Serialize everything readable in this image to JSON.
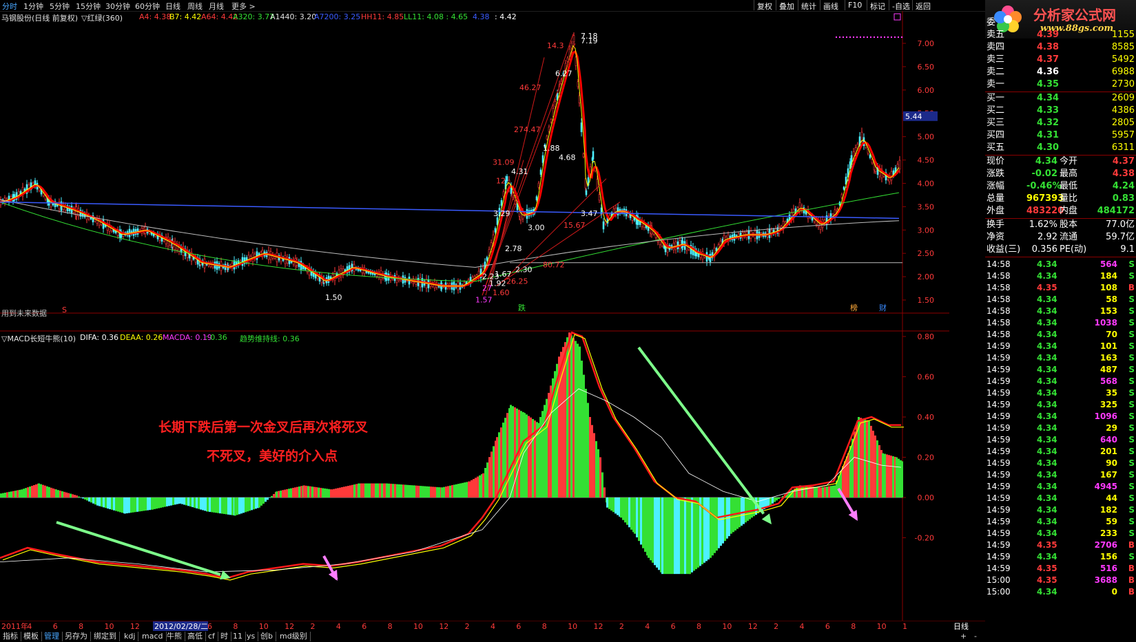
{
  "topbar": {
    "tabs": [
      "分时",
      "1分钟",
      "5分钟",
      "15分钟",
      "30分钟",
      "60分钟",
      "日线",
      "周线",
      "月线",
      "更多 >"
    ],
    "buttons": [
      "复权",
      "叠加",
      "统计",
      "画线",
      "F10",
      "标记",
      "-自选",
      "返回"
    ]
  },
  "logo": {
    "line1": "分析家公式网",
    "line2": "www.88gs.com"
  },
  "main_info": {
    "title": "马钢股份(日线 前复权)",
    "indicator": "▽红绿(360)",
    "items": [
      {
        "label": "A4: 4.38",
        "color": "#ff3a3a"
      },
      {
        "label": "B7: 4.42",
        "color": "#ffff00"
      },
      {
        "label": "A64: 4.42",
        "color": "#ff3a3a"
      },
      {
        "label": "A320: 3.77",
        "color": "#34e034"
      },
      {
        "label": "A1440: 3.20",
        "color": "#e0e0e0"
      },
      {
        "label": "A7200: 3.25",
        "color": "#3a5bff"
      },
      {
        "label": "HH11: 4.85",
        "color": "#ff3a3a"
      },
      {
        "label": "LL11: 4.08 : 4.65",
        "color": "#34e034"
      },
      {
        "label": "4.38",
        "color": "#3a5bff"
      },
      {
        "label": ": 4.42",
        "color": "#ffffff"
      }
    ]
  },
  "macd_info": {
    "title": "▽MACD长短牛熊(10)",
    "items": [
      {
        "label": "DIFA: 0.36",
        "color": "#ffffff"
      },
      {
        "label": "DEAA: 0.26",
        "color": "#ffff00"
      },
      {
        "label": "MACDA: 0.19",
        "color": "#ff3aff"
      },
      {
        "label": ": 0.36",
        "color": "#34e034"
      },
      {
        "label": "趋势维持线: 0.36",
        "color": "#34e034"
      }
    ]
  },
  "future_note": "用到未来数据",
  "annotations": {
    "line1": "长期下跌后第一次金叉后再次将死叉",
    "line2": "不死叉，美好的介入点"
  },
  "price_axis": {
    "labels": [
      "7.00",
      "6.50",
      "6.00",
      "5.50",
      "5.00",
      "4.50",
      "4.00",
      "3.50",
      "3.00",
      "2.50",
      "2.00",
      "1.50"
    ],
    "current": "5.44"
  },
  "macd_axis": {
    "labels": [
      "0.80",
      "0.60",
      "0.40",
      "0.20",
      "0.00",
      "-0.20"
    ]
  },
  "chart_labels": {
    "prices": [
      "7.18",
      "7.19",
      "14.3",
      "6.27",
      "46.27",
      "274.47",
      "31.09",
      "4.31",
      "12",
      "4.68",
      "1.88",
      "3.29",
      "3.00",
      "3.47",
      "15.67",
      "2.78",
      "2.30",
      "80.72",
      "26.25",
      "1.92",
      "1.60",
      "1.50",
      "1.57",
      "2.23",
      "1.67",
      "27"
    ],
    "markers": [
      "跌",
      "榜",
      "财",
      "S"
    ]
  },
  "xaxis": {
    "labels": [
      "2011年",
      "4",
      "6",
      "8",
      "10",
      "12",
      "2",
      "4",
      "6",
      "8",
      "10",
      "12",
      "2",
      "4",
      "6",
      "8",
      "10",
      "12",
      "2",
      "4",
      "6",
      "8",
      "10",
      "12",
      "2",
      "4",
      "6",
      "8",
      "10",
      "12",
      "2",
      "4",
      "6",
      "8",
      "10",
      "1"
    ],
    "cursor": "2012/02/28/二",
    "period": "日线"
  },
  "bottombar": {
    "items": [
      "指标",
      "模板",
      "管理",
      "另存为",
      "绑定到",
      "kdj",
      "macd",
      "牛熊",
      "高低",
      "cf",
      "时",
      "11",
      "ys",
      "创b",
      "md级别"
    ],
    "active": "管理",
    "plus": "+",
    "minus": "-"
  },
  "orderbook": {
    "header": "委",
    "sells": [
      {
        "label": "卖五",
        "price": "4.39",
        "vol": "1155"
      },
      {
        "label": "卖四",
        "price": "4.38",
        "vol": "8585"
      },
      {
        "label": "卖三",
        "price": "4.37",
        "vol": "5492"
      },
      {
        "label": "卖二",
        "price": "4.36",
        "vol": "6988"
      },
      {
        "label": "卖一",
        "price": "4.35",
        "vol": "2730"
      }
    ],
    "buys": [
      {
        "label": "买一",
        "price": "4.34",
        "vol": "2609"
      },
      {
        "label": "买二",
        "price": "4.33",
        "vol": "4386"
      },
      {
        "label": "买三",
        "price": "4.32",
        "vol": "2805"
      },
      {
        "label": "买四",
        "price": "4.31",
        "vol": "5957"
      },
      {
        "label": "买五",
        "price": "4.30",
        "vol": "6311"
      }
    ]
  },
  "quote": [
    {
      "l1": "现价",
      "v1": "4.34",
      "c1": "#34e034",
      "l2": "今开",
      "v2": "4.37",
      "c2": "#ff3a3a"
    },
    {
      "l1": "涨跌",
      "v1": "-0.02",
      "c1": "#34e034",
      "l2": "最高",
      "v2": "4.38",
      "c2": "#ff3a3a"
    },
    {
      "l1": "涨幅",
      "v1": "-0.46%",
      "c1": "#34e034",
      "l2": "最低",
      "v2": "4.24",
      "c2": "#34e034"
    },
    {
      "l1": "总量",
      "v1": "967393",
      "c1": "#ffff00",
      "l2": "量比",
      "v2": "0.83",
      "c2": "#34e034"
    },
    {
      "l1": "外盘",
      "v1": "483220",
      "c1": "#ff3a3a",
      "l2": "内盘",
      "v2": "484172",
      "c2": "#34e034"
    }
  ],
  "stats": [
    {
      "l1": "换手",
      "v1": "1.62%",
      "l2": "股本",
      "v2": "77.0亿"
    },
    {
      "l1": "净资",
      "v1": "2.92",
      "l2": "流通",
      "v2": "59.7亿"
    },
    {
      "l1": "收益(三)",
      "v1": "0.356",
      "l2": "PE(动)",
      "v2": "9.1"
    }
  ],
  "ticks": [
    {
      "t": "14:58",
      "p": "4.34",
      "v": "564",
      "s": "S"
    },
    {
      "t": "14:58",
      "p": "4.34",
      "v": "184",
      "s": "S"
    },
    {
      "t": "14:58",
      "p": "4.35",
      "v": "108",
      "s": "B"
    },
    {
      "t": "14:58",
      "p": "4.34",
      "v": "58",
      "s": "S"
    },
    {
      "t": "14:58",
      "p": "4.34",
      "v": "153",
      "s": "S"
    },
    {
      "t": "14:58",
      "p": "4.34",
      "v": "1038",
      "s": "S"
    },
    {
      "t": "14:58",
      "p": "4.34",
      "v": "70",
      "s": "S"
    },
    {
      "t": "14:59",
      "p": "4.34",
      "v": "101",
      "s": "S"
    },
    {
      "t": "14:59",
      "p": "4.34",
      "v": "163",
      "s": "S"
    },
    {
      "t": "14:59",
      "p": "4.34",
      "v": "487",
      "s": "S"
    },
    {
      "t": "14:59",
      "p": "4.34",
      "v": "568",
      "s": "S"
    },
    {
      "t": "14:59",
      "p": "4.34",
      "v": "35",
      "s": "S"
    },
    {
      "t": "14:59",
      "p": "4.34",
      "v": "325",
      "s": "S"
    },
    {
      "t": "14:59",
      "p": "4.34",
      "v": "1096",
      "s": "S"
    },
    {
      "t": "14:59",
      "p": "4.34",
      "v": "29",
      "s": "S"
    },
    {
      "t": "14:59",
      "p": "4.34",
      "v": "640",
      "s": "S"
    },
    {
      "t": "14:59",
      "p": "4.34",
      "v": "201",
      "s": "S"
    },
    {
      "t": "14:59",
      "p": "4.34",
      "v": "90",
      "s": "S"
    },
    {
      "t": "14:59",
      "p": "4.34",
      "v": "167",
      "s": "S"
    },
    {
      "t": "14:59",
      "p": "4.34",
      "v": "4945",
      "s": "S"
    },
    {
      "t": "14:59",
      "p": "4.34",
      "v": "44",
      "s": "S"
    },
    {
      "t": "14:59",
      "p": "4.34",
      "v": "182",
      "s": "S"
    },
    {
      "t": "14:59",
      "p": "4.34",
      "v": "59",
      "s": "S"
    },
    {
      "t": "14:59",
      "p": "4.34",
      "v": "233",
      "s": "S"
    },
    {
      "t": "14:59",
      "p": "4.35",
      "v": "2706",
      "s": "B"
    },
    {
      "t": "14:59",
      "p": "4.34",
      "v": "156",
      "s": "S"
    },
    {
      "t": "14:59",
      "p": "4.35",
      "v": "516",
      "s": "B"
    },
    {
      "t": "15:00",
      "p": "4.35",
      "v": "3688",
      "s": "B"
    },
    {
      "t": "15:00",
      "p": "4.34",
      "v": "0",
      "s": "B"
    }
  ],
  "colors": {
    "up": "#ff3a3a",
    "down": "#34e034",
    "cyan": "#4df0ff",
    "grid": "#8b0000"
  }
}
